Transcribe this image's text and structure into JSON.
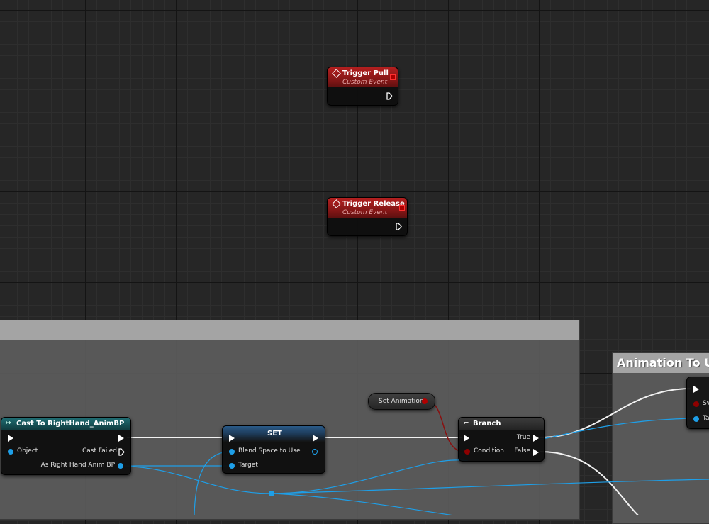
{
  "nodes": {
    "trigger_pull": {
      "title": "Trigger Pull",
      "subtitle": "Custom Event"
    },
    "trigger_release": {
      "title": "Trigger Release",
      "subtitle": "Custom Event"
    },
    "cast": {
      "title": "Cast To RightHand_AnimBP",
      "object_label": "Object",
      "cast_failed_label": "Cast Failed",
      "output_label": "As Right Hand Anim BP"
    },
    "set": {
      "title": "SET",
      "var_label": "Blend Space to Use",
      "target_label": "Target"
    },
    "set_animation": {
      "label": "Set Animation"
    },
    "branch": {
      "title": "Branch",
      "condition_label": "Condition",
      "true_label": "True",
      "false_label": "False"
    },
    "right_node": {
      "pin1_label": "Sw",
      "pin2_label": "Ta"
    }
  },
  "comments": {
    "animation_to_use": "Animation To Us"
  },
  "colors": {
    "event_header": "#9a1a1a",
    "object_pin": "#1e9fe8",
    "bool_pin": "#8e0000",
    "exec_wire": "#ffffff"
  }
}
